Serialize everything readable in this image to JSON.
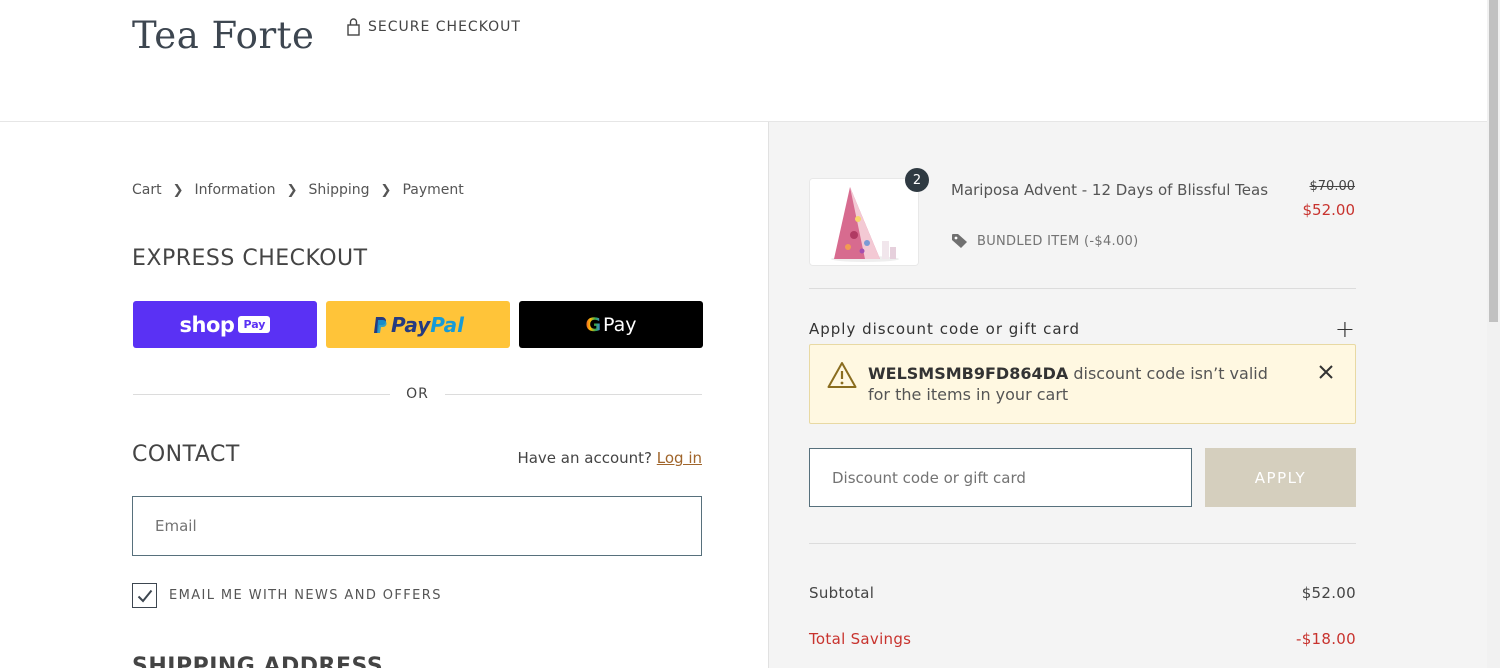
{
  "header": {
    "logo": "Tea Forte",
    "secure_label": "SECURE CHECKOUT"
  },
  "breadcrumb": [
    "Cart",
    "Information",
    "Shipping",
    "Payment"
  ],
  "express": {
    "title": "EXPRESS CHECKOUT",
    "shoppay_word": "shop",
    "shoppay_pill": "Pay",
    "paypal_a": "Pay",
    "paypal_b": "Pal",
    "gpay_g": "G",
    "gpay_word": "Pay",
    "or_label": "OR"
  },
  "contact": {
    "title": "CONTACT",
    "account_prompt": "Have an account?",
    "login_label": "Log in",
    "email_placeholder": "Email",
    "email_value": "",
    "newsletter_label": "EMAIL ME WITH NEWS AND OFFERS",
    "newsletter_checked": true
  },
  "shipping": {
    "title": "SHIPPING ADDRESS"
  },
  "cart": {
    "item": {
      "name": "Mariposa Advent - 12 Days of Blissful Teas",
      "quantity": "2",
      "bundle_label": "BUNDLED ITEM (-$4.00)",
      "original_price": "$70.00",
      "price": "$52.00"
    },
    "discount": {
      "toggle_label": "Apply discount code or gift card",
      "alert_code": "WELSMSMB9FD864DA",
      "alert_text": " discount code isn’t valid for the items in your cart",
      "input_placeholder": "Discount code or gift card",
      "apply_label": "APPLY"
    },
    "summary": {
      "subtotal_label": "Subtotal",
      "subtotal_value": "$52.00",
      "savings_label": "Total Savings",
      "savings_value": "-$18.00"
    }
  },
  "colors": {
    "shoppay": "#5a31f4",
    "paypal": "#ffc439",
    "gpay": "#000000",
    "sale_red": "#c8332e",
    "link_brown": "#a0652b",
    "alert_bg": "#fff8e1",
    "apply_btn": "#d5cfbe"
  }
}
